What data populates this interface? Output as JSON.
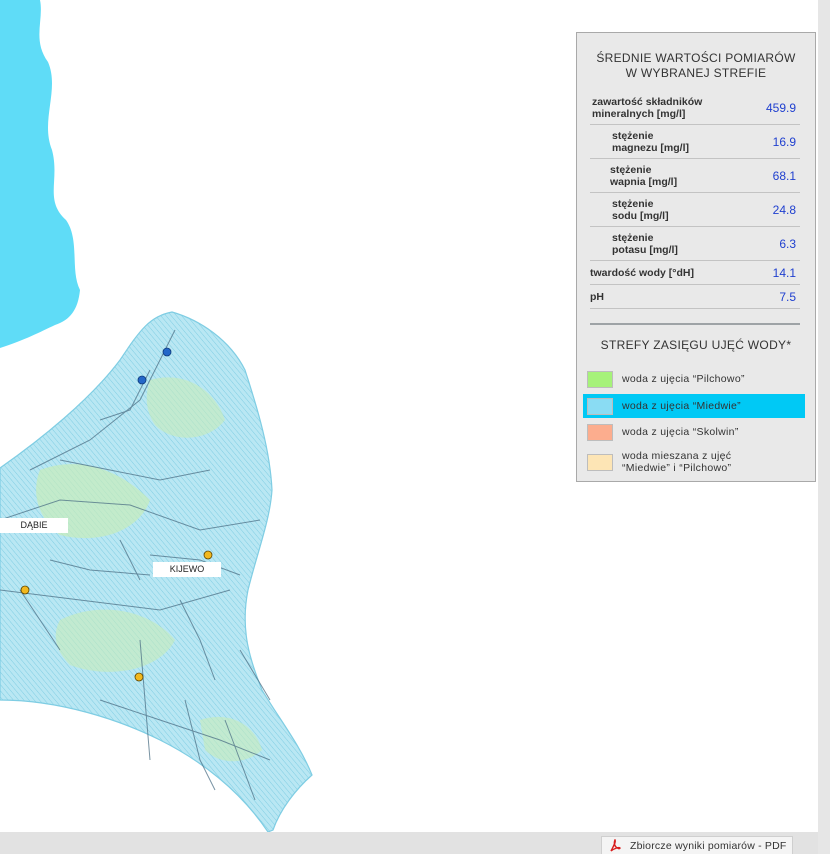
{
  "map": {
    "places": [
      "DĄBIE",
      "KIJEWO"
    ],
    "zone_fill": "#b5e6f2",
    "lake_color": "#5fdcf7",
    "well_colors": {
      "blue": "#2467c8",
      "yellow": "#f2b81e"
    }
  },
  "avg_panel": {
    "title_line1": "ŚREDNIE WARTOŚCI POMIARÓW",
    "title_line2": "W WYBRANEJ STREFIE",
    "rows": [
      {
        "label_line1": "zawartość składników",
        "label_line2": "mineralnych [mg/l]",
        "value": "459.9"
      },
      {
        "label_line1": "stężenie",
        "label_line2": "magnezu [mg/l]",
        "value": "16.9"
      },
      {
        "label_line1": "stężenie",
        "label_line2": "wapnia [mg/l]",
        "value": "68.1"
      },
      {
        "label_line1": "stężenie",
        "label_line2": "sodu [mg/l]",
        "value": "24.8"
      },
      {
        "label_line1": "stężenie",
        "label_line2": "potasu [mg/l]",
        "value": "6.3"
      },
      {
        "label_line1": "twardość wody [°dH]",
        "label_line2": "",
        "value": "14.1"
      },
      {
        "label_line1": "pH",
        "label_line2": "",
        "value": "7.5"
      }
    ]
  },
  "zones_panel": {
    "title": "STREFY ZASIĘGU UJĘĆ WODY*",
    "zones": [
      {
        "label_line1": "woda z ujęcia “Pilchowo”",
        "label_line2": "",
        "color": "#a6f27a",
        "selected": false
      },
      {
        "label_line1": "woda z ujęcia “Miedwie”",
        "label_line2": "",
        "color": "#8adcf3",
        "selected": true
      },
      {
        "label_line1": "woda z ujęcia “Skolwin”",
        "label_line2": "",
        "color": "#fcad8e",
        "selected": false
      },
      {
        "label_line1": "woda mieszana z ujęć",
        "label_line2": "“Miedwie” i “Pilchowo”",
        "color": "#fde5b5",
        "selected": false
      }
    ]
  },
  "footer": {
    "pdf_label": "Zbiorcze wyniki pomiarów - PDF"
  }
}
